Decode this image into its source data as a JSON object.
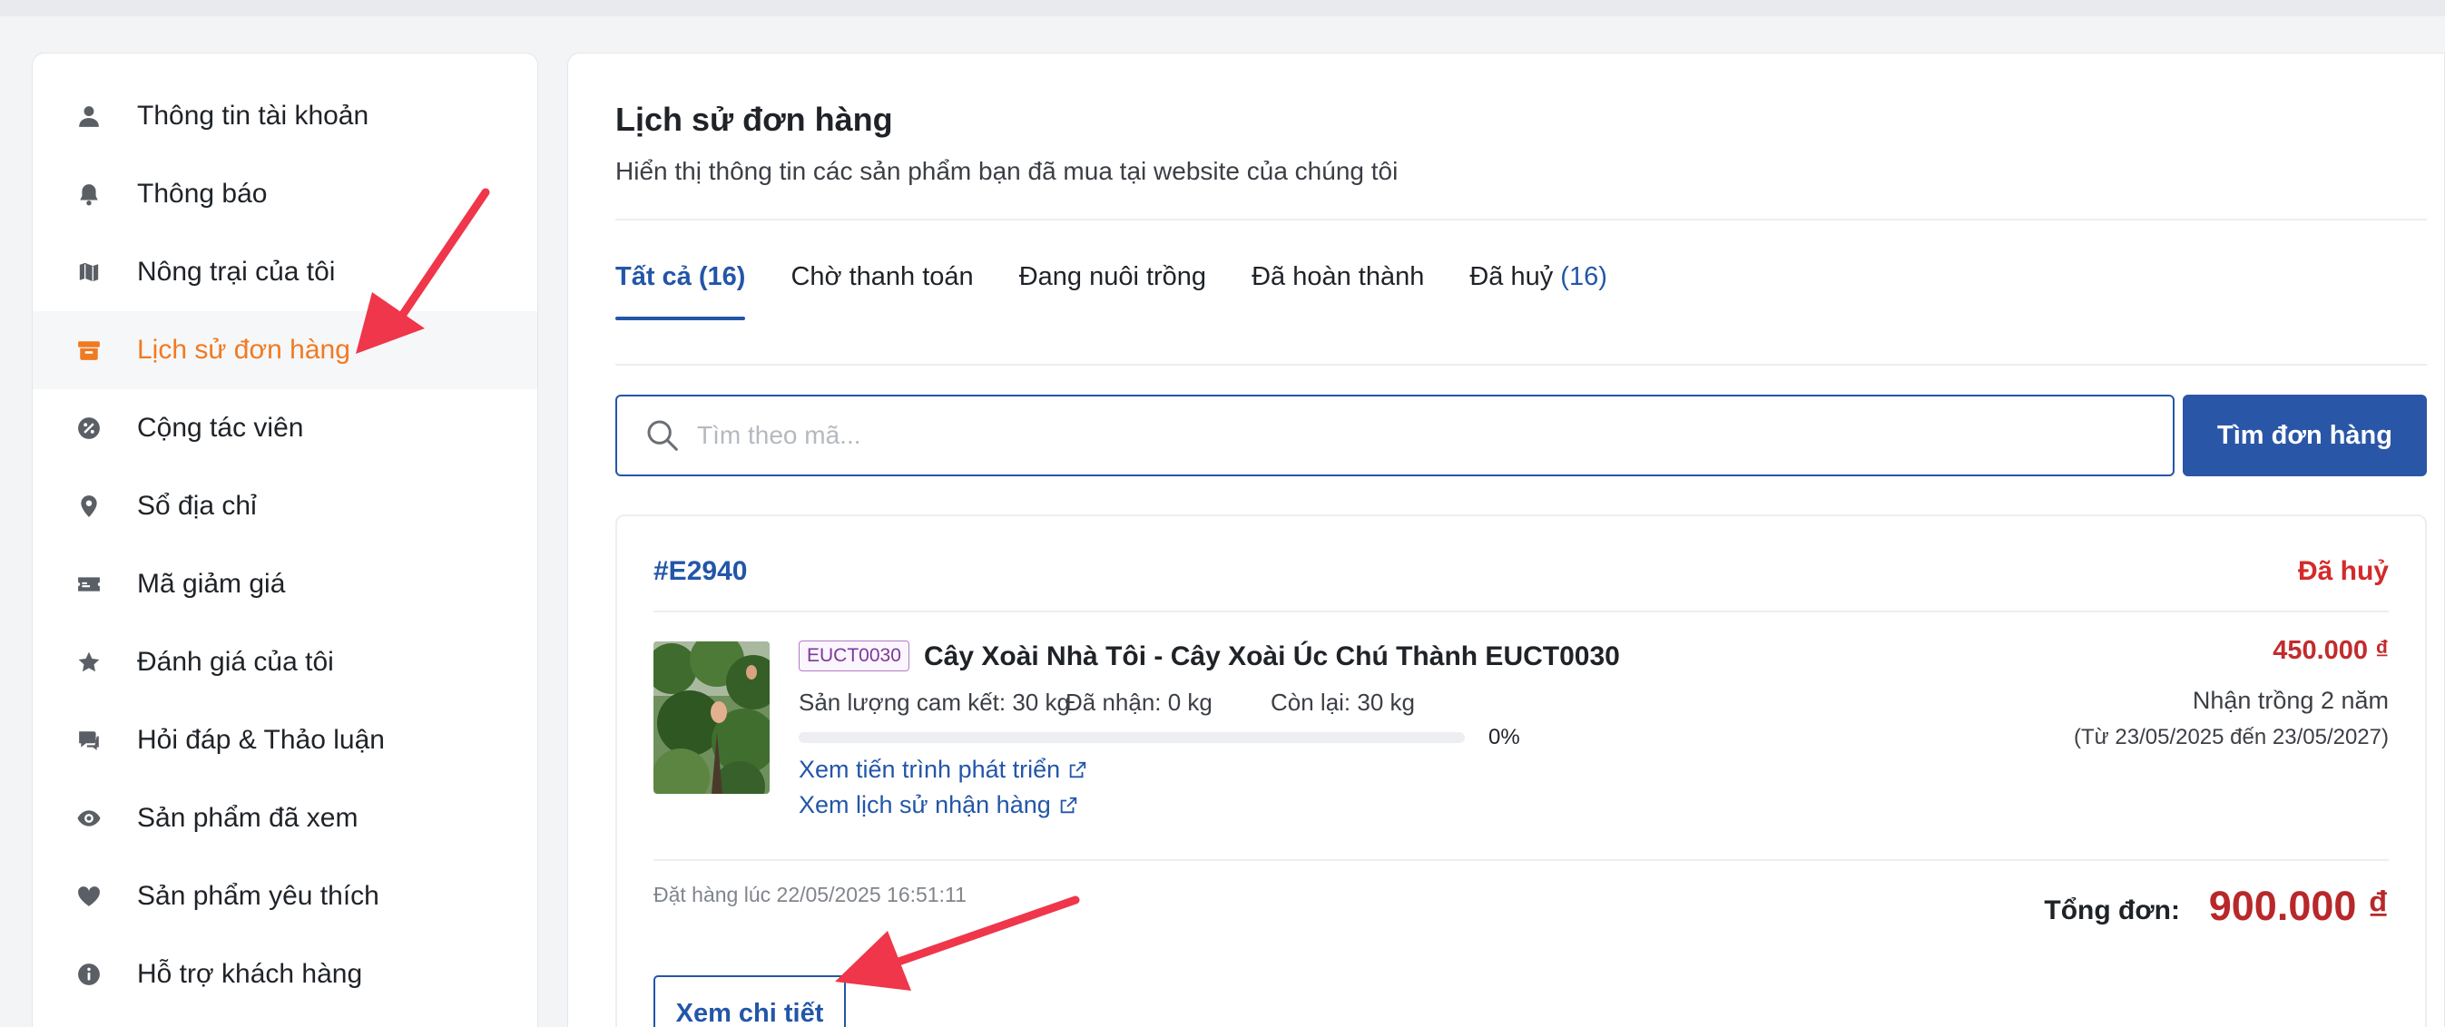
{
  "sidebar": {
    "items": [
      {
        "label": "Thông tin tài khoản",
        "icon": "user-icon"
      },
      {
        "label": "Thông báo",
        "icon": "bell-icon"
      },
      {
        "label": "Nông trại của tôi",
        "icon": "map-icon"
      },
      {
        "label": "Lịch sử đơn hàng",
        "icon": "archive-box-icon",
        "active": true
      },
      {
        "label": "Cộng tác viên",
        "icon": "percent-badge-icon"
      },
      {
        "label": "Sổ địa chỉ",
        "icon": "map-pin-icon"
      },
      {
        "label": "Mã giảm giá",
        "icon": "ticket-icon"
      },
      {
        "label": "Đánh giá của tôi",
        "icon": "star-icon"
      },
      {
        "label": "Hỏi đáp & Thảo luận",
        "icon": "chat-icon"
      },
      {
        "label": "Sản phẩm đã xem",
        "icon": "eye-icon"
      },
      {
        "label": "Sản phẩm yêu thích",
        "icon": "heart-icon"
      },
      {
        "label": "Hỗ trợ khách hàng",
        "icon": "info-icon"
      }
    ]
  },
  "header": {
    "title": "Lịch sử đơn hàng",
    "subtitle": "Hiển thị thông tin các sản phẩm bạn đã mua tại website của chúng tôi"
  },
  "tabs": [
    {
      "label": "Tất cả",
      "count": "(16)"
    },
    {
      "label": "Chờ thanh toán",
      "count": ""
    },
    {
      "label": "Đang nuôi trồng",
      "count": ""
    },
    {
      "label": "Đã hoàn thành",
      "count": ""
    },
    {
      "label": "Đã huỷ",
      "count": "(16)"
    }
  ],
  "search": {
    "placeholder": "Tìm theo mã...",
    "value": "",
    "button_label": "Tìm đơn hàng"
  },
  "order": {
    "id": "#E2940",
    "status": "Đã huỷ",
    "product": {
      "code": "EUCT0030",
      "name": "Cây Xoài Nhà Tôi - Cây Xoài Úc Chú Thành EUCT0030",
      "committed": "Sản lượng cam kết: 30 kg",
      "received": "Đã nhận: 0 kg",
      "remaining": "Còn lại: 30 kg",
      "progress_percent": 0,
      "progress_label": "0%",
      "link_growth": "Xem tiến trình phát triển",
      "link_history": "Xem lịch sử nhận hàng",
      "price": "450.000 ₫",
      "term": "Nhận trồng 2 năm",
      "range": "(Từ 23/05/2025 đến 23/05/2027)"
    },
    "ordered_at": "Đặt hàng lúc 22/05/2025 16:51:11",
    "total_label": "Tổng đơn:",
    "total_value": "900.000 ₫",
    "detail_button": "Xem chi tiết"
  },
  "colors": {
    "accent": "#2356a8",
    "active_sidebar": "#f07a22",
    "cancel": "#d42a2a",
    "price": "#c22c2c",
    "annotation_arrow": "#f0364a"
  }
}
